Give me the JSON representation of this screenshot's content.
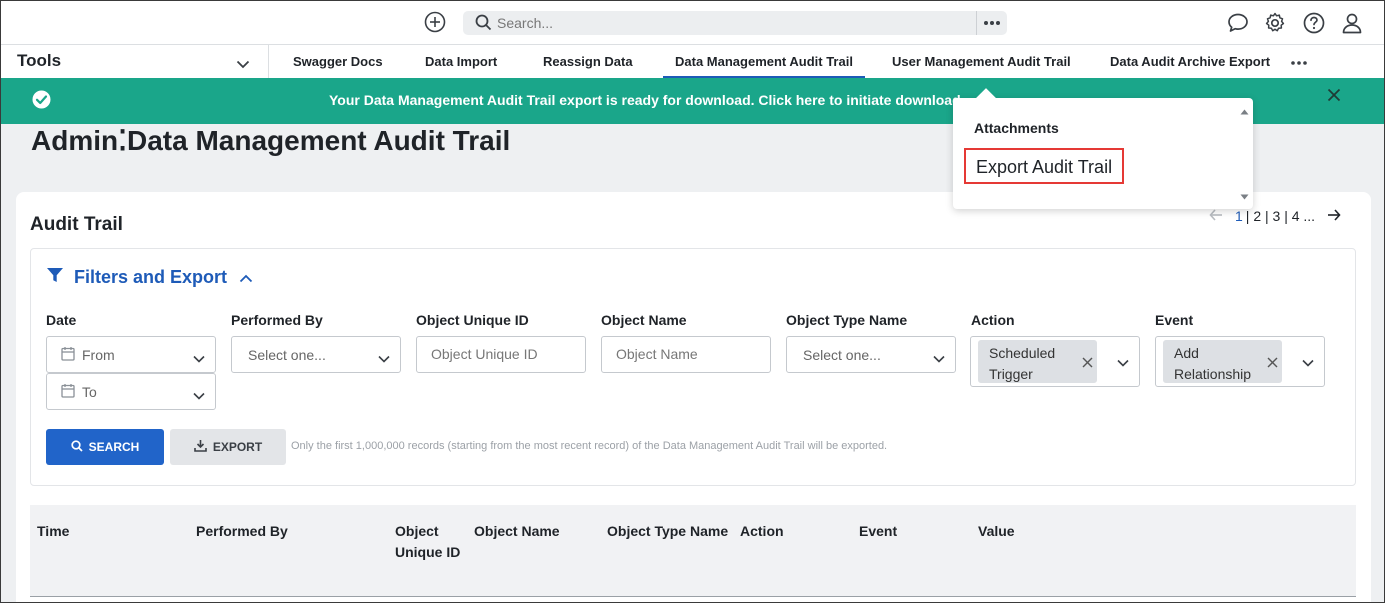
{
  "search": {
    "placeholder": "Search..."
  },
  "tools": {
    "label": "Tools"
  },
  "tabs": [
    {
      "label": "Swagger Docs"
    },
    {
      "label": "Data Import"
    },
    {
      "label": "Reassign Data"
    },
    {
      "label": "Data Management Audit Trail",
      "active": true
    },
    {
      "label": "User Management Audit Trail"
    },
    {
      "label": "Data Audit Archive Export"
    }
  ],
  "banner": {
    "message": "Your Data Management Audit Trail export is ready for download. Click here to initiate download.",
    "color": "#1aa68a"
  },
  "page": {
    "title": "Admin⁚Data Management Audit Trail"
  },
  "card": {
    "title": "Audit Trail"
  },
  "pager": {
    "current": "1",
    "rest": "| 2 | 3 | 4 ..."
  },
  "filters": {
    "title": "Filters and Export",
    "date_label": "Date",
    "date_from": "From",
    "date_to": "To",
    "performed_by_label": "Performed By",
    "performed_by_value": "Select one...",
    "object_uid_label": "Object Unique ID",
    "object_uid_placeholder": "Object Unique ID",
    "object_name_label": "Object Name",
    "object_name_placeholder": "Object Name",
    "object_type_label": "Object Type Name",
    "object_type_value": "Select one...",
    "action_label": "Action",
    "action_chip": "Scheduled Trigger",
    "event_label": "Event",
    "event_chip": "Add Relationship",
    "search_button": "SEARCH",
    "export_button": "EXPORT",
    "note": "Only the first 1,000,000 records (starting from the most recent record) of the Data Management Audit Trail will be exported."
  },
  "table": {
    "columns": [
      "Time",
      "Performed By",
      "Object Unique ID",
      "Object Name",
      "Object Type Name",
      "Action",
      "Event",
      "Value"
    ]
  },
  "attachments": {
    "title": "Attachments",
    "item": "Export Audit Trail"
  },
  "colors": {
    "accent": "#1e5bb8",
    "highlight": "#e53935"
  }
}
